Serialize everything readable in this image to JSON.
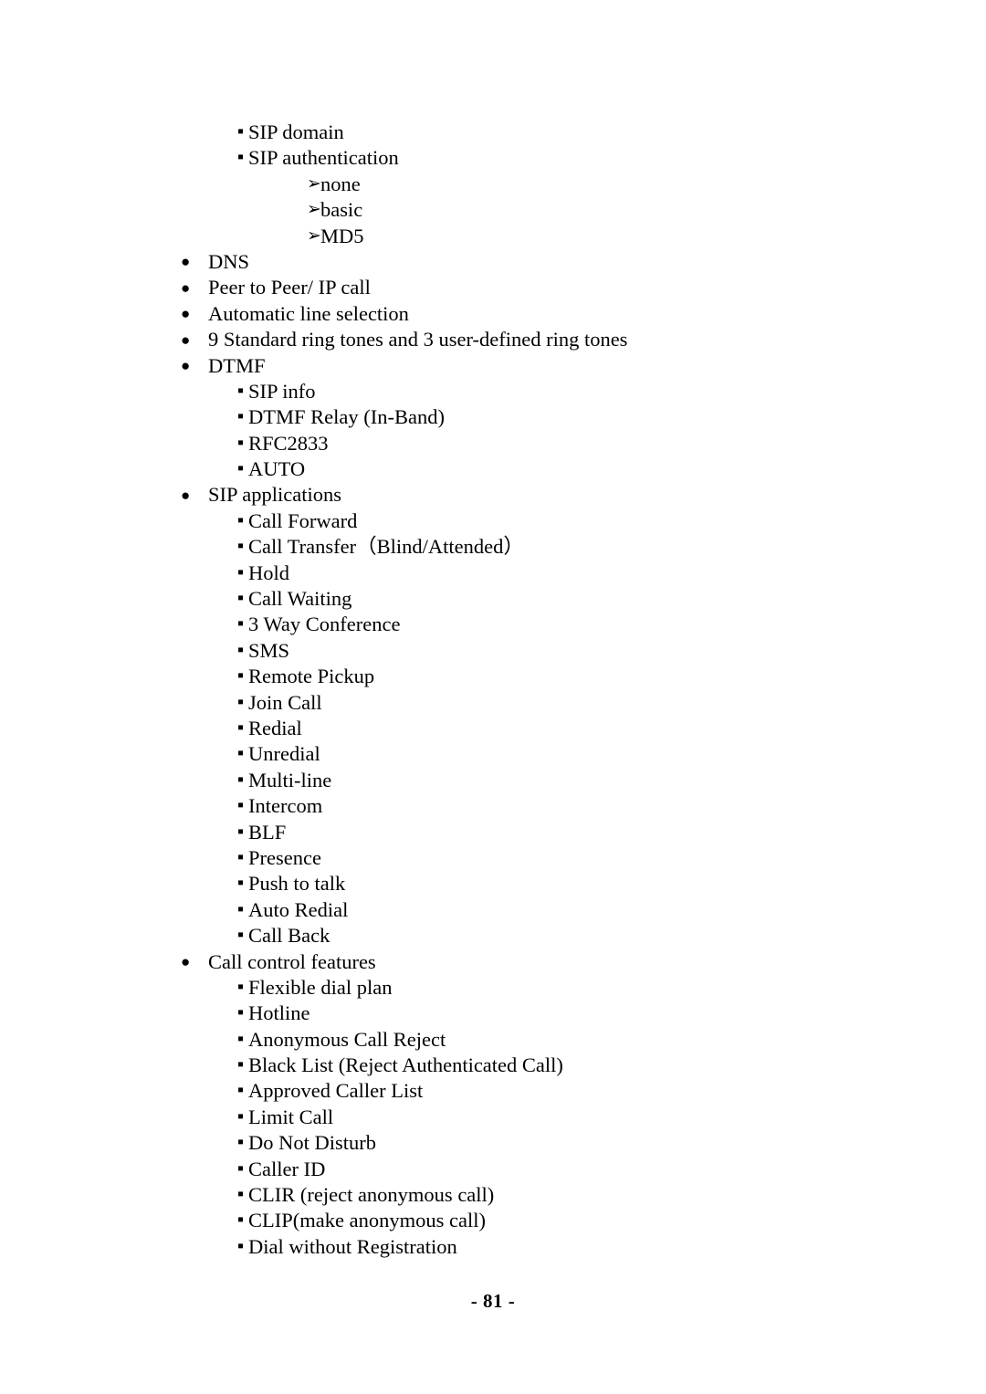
{
  "document": {
    "page_number_label": "- 81 -",
    "bullet_glyphs": {
      "level1": "●",
      "level2": "▪",
      "level3": "➢"
    },
    "items": [
      {
        "level": 2,
        "text": "SIP domain"
      },
      {
        "level": 2,
        "text": "SIP authentication"
      },
      {
        "level": 3,
        "text": "none"
      },
      {
        "level": 3,
        "text": "basic"
      },
      {
        "level": 3,
        "text": "MD5"
      },
      {
        "level": 1,
        "text": "DNS"
      },
      {
        "level": 1,
        "text": "Peer to Peer/ IP call"
      },
      {
        "level": 1,
        "text": "Automatic line selection"
      },
      {
        "level": 1,
        "text": "9 Standard ring tones and 3 user-defined ring tones"
      },
      {
        "level": 1,
        "text": "DTMF"
      },
      {
        "level": 2,
        "text": "SIP info"
      },
      {
        "level": 2,
        "text": "DTMF Relay (In-Band)"
      },
      {
        "level": 2,
        "text": "RFC2833"
      },
      {
        "level": 2,
        "text": "AUTO"
      },
      {
        "level": 1,
        "text": "SIP applications"
      },
      {
        "level": 2,
        "text": "Call Forward"
      },
      {
        "level": 2,
        "text": "Call Transfer（Blind/Attended）"
      },
      {
        "level": 2,
        "text": "Hold"
      },
      {
        "level": 2,
        "text": "Call Waiting"
      },
      {
        "level": 2,
        "text": "3 Way Conference"
      },
      {
        "level": 2,
        "text": "SMS"
      },
      {
        "level": 2,
        "text": "Remote Pickup"
      },
      {
        "level": 2,
        "text": "Join Call"
      },
      {
        "level": 2,
        "text": "Redial"
      },
      {
        "level": 2,
        "text": "Unredial"
      },
      {
        "level": 2,
        "text": "Multi-line"
      },
      {
        "level": 2,
        "text": "Intercom"
      },
      {
        "level": 2,
        "text": "BLF"
      },
      {
        "level": 2,
        "text": "Presence"
      },
      {
        "level": 2,
        "text": "Push to talk"
      },
      {
        "level": 2,
        "text": "Auto Redial"
      },
      {
        "level": 2,
        "text": "Call Back"
      },
      {
        "level": 1,
        "text": "Call control features"
      },
      {
        "level": 2,
        "text": "Flexible dial plan"
      },
      {
        "level": 2,
        "text": "Hotline"
      },
      {
        "level": 2,
        "text": "Anonymous Call Reject"
      },
      {
        "level": 2,
        "text": "Black List (Reject Authenticated Call)"
      },
      {
        "level": 2,
        "text": "Approved Caller List"
      },
      {
        "level": 2,
        "text": "Limit Call"
      },
      {
        "level": 2,
        "text": "Do Not Disturb"
      },
      {
        "level": 2,
        "text": "Caller ID"
      },
      {
        "level": 2,
        "text": "CLIR (reject anonymous call)"
      },
      {
        "level": 2,
        "text": "CLIP(make anonymous call)"
      },
      {
        "level": 2,
        "text": "Dial without Registration"
      }
    ]
  }
}
